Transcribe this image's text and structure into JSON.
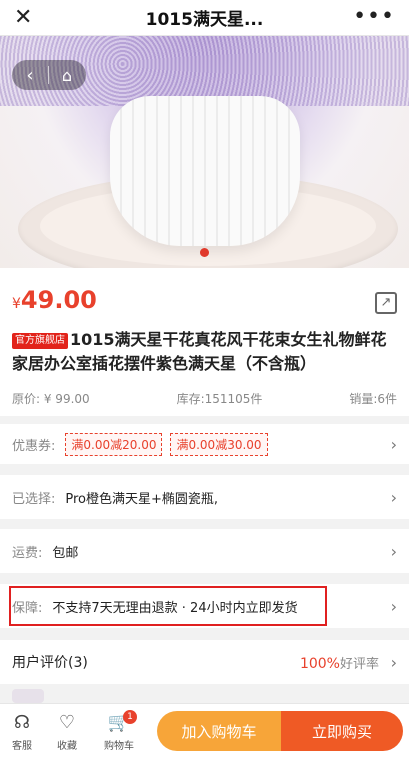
{
  "nav": {
    "close_icon": "✕",
    "title": "1015满天星...",
    "more_icon": "•••"
  },
  "hero": {
    "back_icon": "‹",
    "home_icon": "⌂"
  },
  "product": {
    "currency": "¥",
    "price": "49.00",
    "shop_tag": "官方旗舰店",
    "title": "1015满天星干花真花风干花束女生礼物鲜花家居办公室插花摆件紫色满天星（不含瓶）",
    "original_price": "原价: ¥ 99.00",
    "stock": "库存:151105件",
    "sales": "销量:6件"
  },
  "coupons": {
    "label": "优惠券:",
    "items": [
      "满0.00减20.00",
      "满0.00减30.00"
    ]
  },
  "selected": {
    "label": "已选择:",
    "value": "Pro橙色满天星+椭圆瓷瓶,"
  },
  "shipping": {
    "label": "运费:",
    "value": "包邮"
  },
  "guarantee": {
    "label": "保障:",
    "value": "不支持7天无理由退款 · 24小时内立即发货"
  },
  "reviews": {
    "title": "用户评价(3)",
    "percent": "100%",
    "rate_label": "好评率"
  },
  "bottom_bar": {
    "service": "客服",
    "favorite": "收藏",
    "cart": "购物车",
    "cart_count": "1",
    "add_to_cart": "加入购物车",
    "buy_now": "立即购买"
  },
  "colors": {
    "accent": "#e8412c",
    "cart_button": "#f7a539",
    "buy_button": "#ef5a25",
    "highlight_box": "#e02020"
  }
}
